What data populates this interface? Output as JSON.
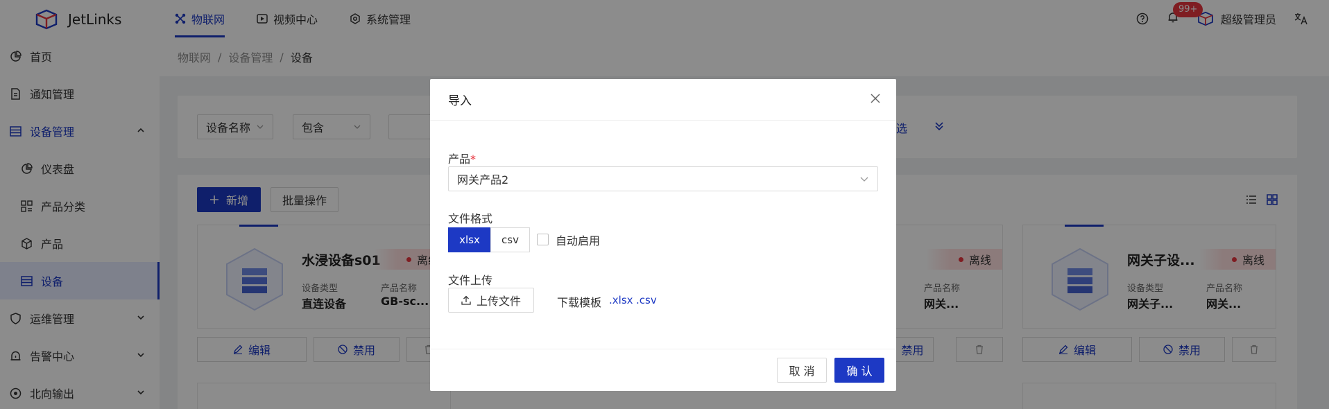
{
  "app": {
    "name": "JetLinks"
  },
  "topnav": [
    {
      "label": "物联网",
      "icon": "iot-icon",
      "active": true
    },
    {
      "label": "视频中心",
      "icon": "video-icon",
      "active": false
    },
    {
      "label": "系统管理",
      "icon": "system-icon",
      "active": false
    }
  ],
  "header": {
    "notification_count": "99+",
    "user_name": "超级管理员"
  },
  "sidebar": {
    "items": [
      {
        "label": "首页",
        "icon": "pie-chart-icon"
      },
      {
        "label": "通知管理",
        "icon": "document-icon"
      },
      {
        "label": "设备管理",
        "icon": "list-icon"
      },
      {
        "label": "仪表盘",
        "icon": "dashboard-icon"
      },
      {
        "label": "产品分类",
        "icon": "category-icon"
      },
      {
        "label": "产品",
        "icon": "cube-icon"
      },
      {
        "label": "设备",
        "icon": "device-list-icon"
      },
      {
        "label": "运维管理",
        "icon": "shield-icon"
      },
      {
        "label": "告警中心",
        "icon": "alarm-icon"
      },
      {
        "label": "北向输出",
        "icon": "output-icon"
      }
    ]
  },
  "breadcrumb": [
    "物联网",
    "设备管理",
    "设备"
  ],
  "filter": {
    "field": "设备名称",
    "operator": "包含",
    "filter_link": "筛选"
  },
  "toolbar": {
    "add_label": "新增",
    "batch_label": "批量操作"
  },
  "cards": [
    {
      "title": "水浸设备s01",
      "status": "离线",
      "type_label": "设备类型",
      "type_value": "直连设备",
      "product_label": "产品名称",
      "product_value": "GB-sc..."
    },
    {
      "title": "",
      "status": "离线",
      "type_label": "",
      "type_value": "",
      "product_label": "产品名称",
      "product_value": "网关..."
    },
    {
      "title": "网关子设...",
      "status": "离线",
      "type_label": "设备类型",
      "type_value": "网关子...",
      "product_label": "产品名称",
      "product_value": "网关..."
    }
  ],
  "card_actions": {
    "edit": "编辑",
    "disable": "禁用"
  },
  "modal": {
    "title": "导入",
    "product_label": "产品",
    "product_required_mark": "*",
    "product_value": "网关产品2",
    "format_label": "文件格式",
    "formats": [
      "xlsx",
      "csv"
    ],
    "selected_format": "xlsx",
    "auto_enable_label": "自动启用",
    "upload_label": "文件上传",
    "upload_button": "上传文件",
    "download_template_label": "下载模板",
    "template_xlsx": ".xlsx",
    "template_csv": ".csv",
    "cancel_label": "取 消",
    "confirm_label": "确 认"
  },
  "colors": {
    "primary": "#1d39c4",
    "danger": "#e8363f",
    "overlay": "rgba(0,0,0,0.45)"
  }
}
